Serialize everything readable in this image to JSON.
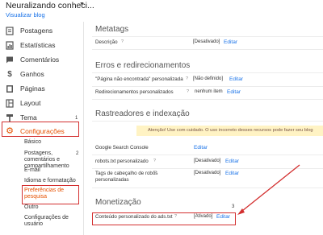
{
  "header": {
    "blog_title": "Neuralizando conheci...",
    "view_blog": "Visualizar blog"
  },
  "sidebar": {
    "items": [
      {
        "label": "Postagens",
        "icon": "posts-icon"
      },
      {
        "label": "Estatísticas",
        "icon": "stats-icon"
      },
      {
        "label": "Comentários",
        "icon": "comments-icon"
      },
      {
        "label": "Ganhos",
        "icon": "dollar-icon"
      },
      {
        "label": "Páginas",
        "icon": "pages-icon"
      },
      {
        "label": "Layout",
        "icon": "layout-icon"
      },
      {
        "label": "Tema",
        "icon": "theme-icon",
        "badge": "1"
      },
      {
        "label": "Configurações",
        "icon": "gear-icon",
        "badge": "2"
      }
    ],
    "sub_items": [
      "Básico",
      "Postagens, comentários e compartilhamento",
      "E-mail",
      "Idioma e formatação",
      "Preferências de pesquisa",
      "Outro",
      "Configurações de usuário"
    ]
  },
  "main": {
    "sections": {
      "metatags": "Metatags",
      "errors": "Erros e redirecionamentos",
      "crawlers": "Rastreadores e indexação",
      "monetization": "Monetização"
    },
    "metatags_rows": [
      {
        "label": "Descrição",
        "value": "[Desativado]",
        "edit": "Editar"
      }
    ],
    "errors_rows": [
      {
        "label": "\"Página não encontrada\" personalizada",
        "value": "[Não definido]",
        "edit": "Editar"
      },
      {
        "label": "Redirecionamentos personalizados",
        "value": "nenhum item",
        "edit": "Editar"
      }
    ],
    "warning": "Atenção! Use com cuidado. O uso incorreto desses recursos pode fazer seu blog",
    "crawler_rows": [
      {
        "label": "Google Search Console",
        "value": "",
        "edit": "Editar"
      },
      {
        "label": "robots.txt personalizado",
        "value": "[Desativado]",
        "edit": "Editar"
      },
      {
        "label": "Tags de cabeçalho de robôs personalizadas",
        "value": "[Desativado]",
        "edit": "Editar"
      }
    ],
    "monetization_rows": [
      {
        "label": "Conteúdo personalizado do ads.txt",
        "value": "[Ativado]",
        "edit": "Editar"
      }
    ],
    "step_number": "3"
  },
  "colors": {
    "accent_orange": "#e65100",
    "link_blue": "#1a73e8",
    "annotation_red": "#d32f2f",
    "warning_bg": "#fff3c4"
  }
}
